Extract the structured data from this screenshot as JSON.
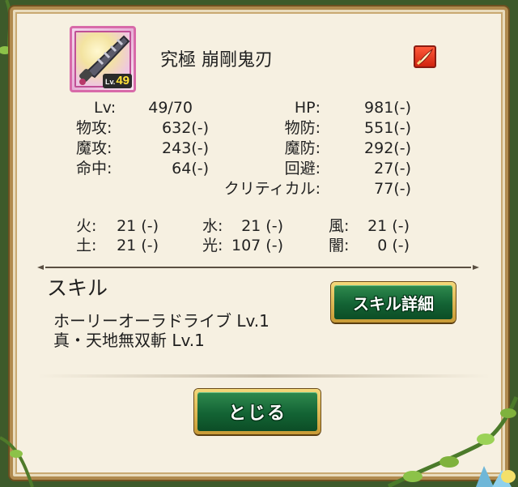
{
  "item": {
    "name": "究極 崩剛鬼刃",
    "level_prefix": "Lv.",
    "level_value": "49",
    "attribute_icon": "fire-attack-icon",
    "rarity_frame_color": "#d86aa9"
  },
  "stats_left": [
    {
      "label": "Lv:",
      "value": "49/70"
    },
    {
      "label": "物攻:",
      "value": "632(-)"
    },
    {
      "label": "魔攻:",
      "value": "243(-)"
    },
    {
      "label": "命中:",
      "value": "64(-)"
    }
  ],
  "stats_right": [
    {
      "label": "HP:",
      "value": "981(-)"
    },
    {
      "label": "物防:",
      "value": "551(-)"
    },
    {
      "label": "魔防:",
      "value": "292(-)"
    },
    {
      "label": "回避:",
      "value": "27(-)"
    },
    {
      "label": "クリティカル:",
      "value": "77(-)"
    }
  ],
  "elements": [
    {
      "label": "火:",
      "value": "21 (-)"
    },
    {
      "label": "水:",
      "value": "21 (-)"
    },
    {
      "label": "風:",
      "value": "21 (-)"
    },
    {
      "label": "土:",
      "value": "21 (-)"
    },
    {
      "label": "光:",
      "value": "107 (-)"
    },
    {
      "label": "闇:",
      "value": "0 (-)"
    }
  ],
  "skills": {
    "title": "スキル",
    "details_button": "スキル詳細",
    "list": [
      "ホーリーオーラドライブ  Lv.1",
      "真・天地無双斬  Lv.1"
    ]
  },
  "close_button": "とじる",
  "colors": {
    "panel_bg": "#f6f0e1",
    "panel_border": "#b08a4e",
    "button_green": "#136334",
    "button_gold": "#c89a35",
    "text": "#222222"
  }
}
